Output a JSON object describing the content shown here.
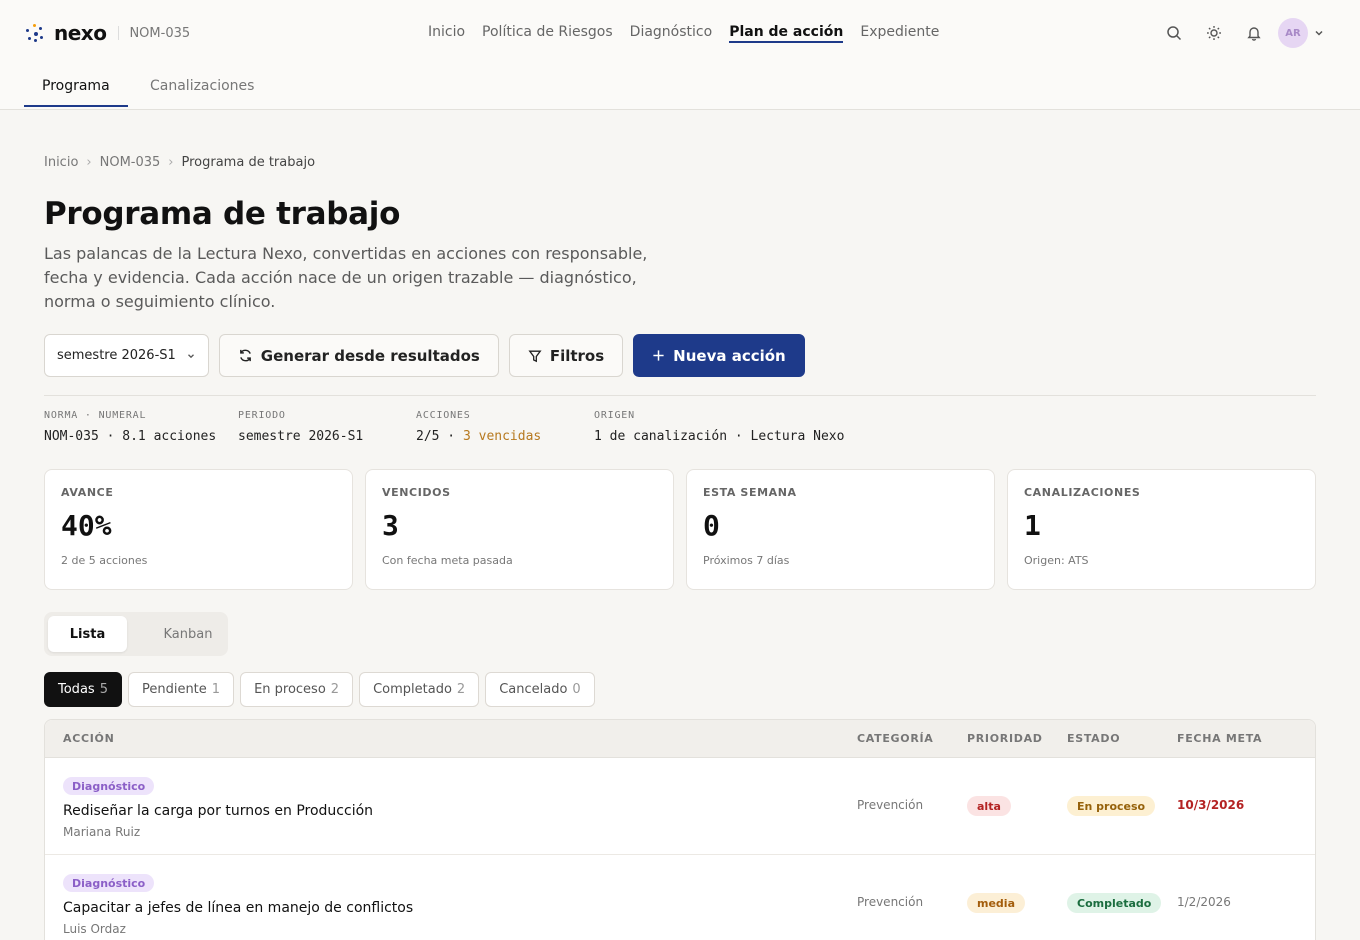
{
  "brand": {
    "name": "nexo",
    "sub": "NOM-035"
  },
  "nav": [
    "Inicio",
    "Política de Riesgos",
    "Diagnóstico",
    "Plan de acción",
    "Expediente"
  ],
  "nav_active_index": 3,
  "user": {
    "initials": "AR"
  },
  "subtabs": [
    "Programa",
    "Canalizaciones"
  ],
  "breadcrumb": [
    "Inicio",
    "NOM-035",
    "Programa de trabajo"
  ],
  "page": {
    "title": "Programa de trabajo",
    "description": "Las palancas de la Lectura Nexo, convertidas en acciones con responsable, fecha y evidencia. Cada acción nace de un origen trazable — diagnóstico, norma o seguimiento clínico."
  },
  "toolbar": {
    "period_select": "semestre 2026-S1",
    "generate_label": "Generar desde resultados",
    "filters_label": "Filtros",
    "new_label": "Nueva acción"
  },
  "meta": [
    {
      "key": "NORMA · NUMERAL",
      "value": "NOM-035 · 8.1 acciones"
    },
    {
      "key": "PERIODO",
      "value": "semestre 2026-S1"
    },
    {
      "key": "ACCIONES",
      "value": "2/5 · ",
      "warn": "3 vencidas"
    },
    {
      "key": "ORIGEN",
      "value": "1 de canalización · Lectura Nexo"
    }
  ],
  "stats": [
    {
      "label": "AVANCE",
      "value": "40%",
      "sub": "2 de 5 acciones"
    },
    {
      "label": "VENCIDOS",
      "value": "3",
      "sub": "Con fecha meta pasada"
    },
    {
      "label": "ESTA SEMANA",
      "value": "0",
      "sub": "Próximos 7 días"
    },
    {
      "label": "CANALIZACIONES",
      "value": "1",
      "sub": "Origen: ATS"
    }
  ],
  "view_toggle": [
    "Lista",
    "Kanban"
  ],
  "filters": [
    {
      "label": "Todas",
      "count": "5"
    },
    {
      "label": "Pendiente",
      "count": "1"
    },
    {
      "label": "En proceso",
      "count": "2"
    },
    {
      "label": "Completado",
      "count": "2"
    },
    {
      "label": "Cancelado",
      "count": "0"
    }
  ],
  "table": {
    "headers": [
      "ACCIÓN",
      "CATEGORÍA",
      "PRIORIDAD",
      "ESTADO",
      "FECHA META"
    ],
    "rows": [
      {
        "tag": "Diagnóstico",
        "title": "Rediseñar la carga por turnos en Producción",
        "owner": "Mariana Ruiz",
        "category": "Prevención",
        "priority": "alta",
        "status": "En proceso",
        "date": "10/3/2026"
      },
      {
        "tag": "Diagnóstico",
        "title": "Capacitar a jefes de línea en manejo de conflictos",
        "owner": "Luis Ordaz",
        "category": "Prevención",
        "priority": "media",
        "status": "Completado",
        "date": "1/2/2026"
      }
    ]
  },
  "colors": {
    "accent": "#1e3a8a",
    "background": "#f7f6f3",
    "overdue": "#b42323",
    "warning": "#b7791f"
  }
}
